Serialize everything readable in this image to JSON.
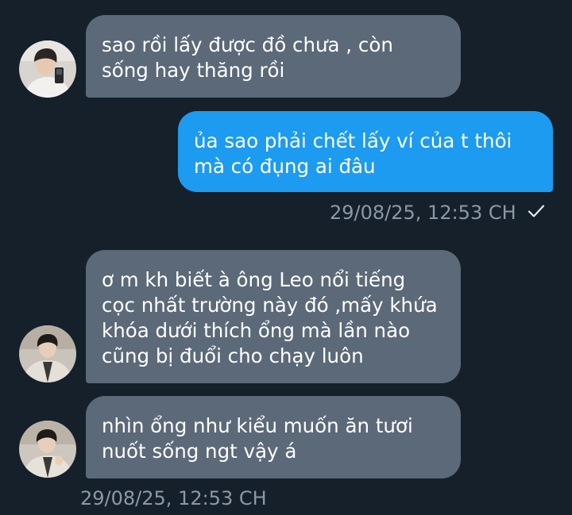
{
  "messages": [
    {
      "direction": "incoming",
      "text": "sao rồi lấy được đồ chưa , còn\nsống hay thăng rồi"
    },
    {
      "direction": "outgoing",
      "text": "ủa sao phải chết lấy ví của t thôi\nmà có đụng ai đâu",
      "timestamp": "29/08/25, 12:53 CH",
      "status_icon": "check-icon"
    },
    {
      "direction": "incoming",
      "text": "ơ m kh biết à ông Leo nổi tiếng\ncọc nhất trường này đó ,mấy khứa\nkhóa dưới thích ổng mà lần nào\ncũng bị đuổi cho chạy luôn"
    },
    {
      "direction": "incoming",
      "text": "nhìn ổng như kiểu muốn ăn tươi\nnuốt sống ngt vậy á",
      "timestamp": "29/08/25, 12:53 CH"
    }
  ],
  "colors": {
    "background": "#15202b",
    "incoming_bubble": "#5b6978",
    "outgoing_bubble": "#1d9bf0",
    "meta_text": "#8b98a5"
  }
}
